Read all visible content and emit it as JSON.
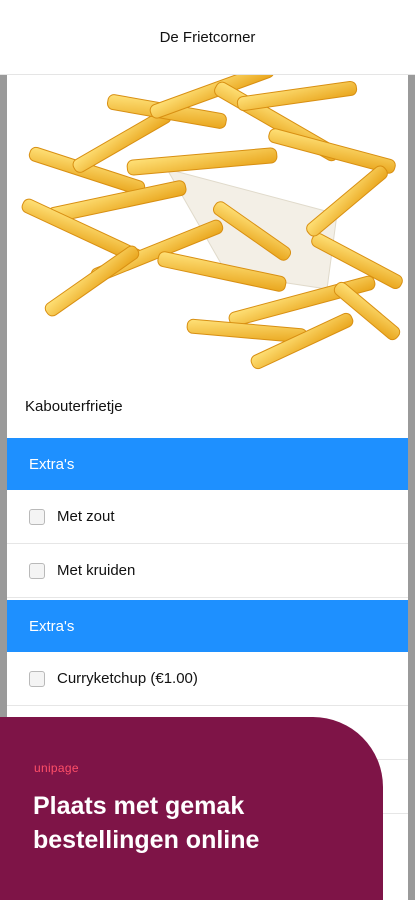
{
  "header": {
    "title": "De Frietcorner"
  },
  "product": {
    "name": "Kabouterfrietje",
    "image_icon": "fries-photo"
  },
  "sections": [
    {
      "title": "Extra's",
      "options": [
        {
          "label": "Met zout",
          "checked": false
        },
        {
          "label": "Met kruiden",
          "checked": false
        }
      ]
    },
    {
      "title": "Extra's",
      "options": [
        {
          "label": "Curryketchup (€1.00)",
          "checked": false
        }
      ]
    }
  ],
  "promo": {
    "brand": "unipage",
    "headline": "Plaats met gemak bestellingen online",
    "background": "#7e1447",
    "brand_color": "#ff4f68"
  },
  "colors": {
    "section_bar": "#1e90ff"
  }
}
